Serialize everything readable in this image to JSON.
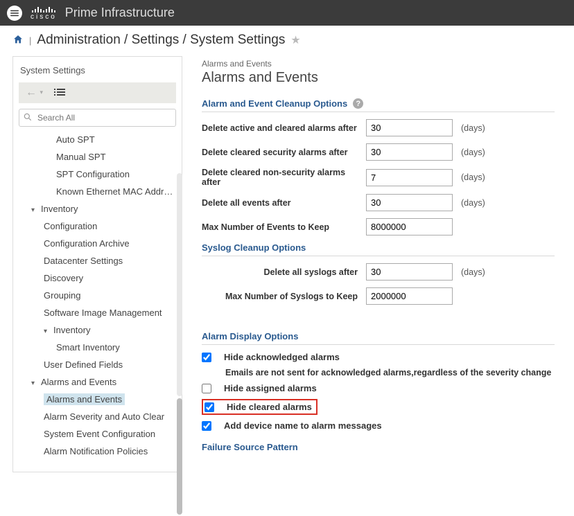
{
  "topbar": {
    "product": "Prime Infrastructure",
    "cisco": "cisco"
  },
  "breadcrumb": {
    "text": "Administration / Settings / System Settings"
  },
  "sidebar": {
    "title": "System Settings",
    "search_placeholder": "Search All",
    "items": [
      {
        "label": "Auto SPT",
        "level": 2,
        "expandable": false
      },
      {
        "label": "Manual SPT",
        "level": 2,
        "expandable": false
      },
      {
        "label": "SPT Configuration",
        "level": 2,
        "expandable": false
      },
      {
        "label": "Known Ethernet MAC Address List",
        "level": 2,
        "expandable": false
      },
      {
        "label": "Inventory",
        "level": 0,
        "expandable": true
      },
      {
        "label": "Configuration",
        "level": 1,
        "expandable": false
      },
      {
        "label": "Configuration Archive",
        "level": 1,
        "expandable": false
      },
      {
        "label": "Datacenter Settings",
        "level": 1,
        "expandable": false
      },
      {
        "label": "Discovery",
        "level": 1,
        "expandable": false
      },
      {
        "label": "Grouping",
        "level": 1,
        "expandable": false
      },
      {
        "label": "Software Image Management",
        "level": 1,
        "expandable": false
      },
      {
        "label": "Inventory",
        "level": 1,
        "expandable": true
      },
      {
        "label": "Smart Inventory",
        "level": 2,
        "expandable": false
      },
      {
        "label": "User Defined Fields",
        "level": 1,
        "expandable": false
      },
      {
        "label": "Alarms and Events",
        "level": 0,
        "expandable": true
      },
      {
        "label": "Alarms and Events",
        "level": 1,
        "expandable": false,
        "selected": true
      },
      {
        "label": "Alarm Severity and Auto Clear",
        "level": 1,
        "expandable": false
      },
      {
        "label": "System Event Configuration",
        "level": 1,
        "expandable": false
      },
      {
        "label": "Alarm Notification Policies",
        "level": 1,
        "expandable": false
      }
    ]
  },
  "main": {
    "crumb": "Alarms and Events",
    "title": "Alarms and Events",
    "sections": {
      "cleanup": {
        "header": "Alarm and Event Cleanup Options",
        "rows": [
          {
            "label": "Delete active and cleared alarms after",
            "value": "30",
            "unit": "(days)"
          },
          {
            "label": "Delete cleared security alarms after",
            "value": "30",
            "unit": "(days)"
          },
          {
            "label": "Delete cleared non-security alarms after",
            "value": "7",
            "unit": "(days)"
          },
          {
            "label": "Delete all events after",
            "value": "30",
            "unit": "(days)"
          },
          {
            "label": "Max Number of Events to Keep",
            "value": "8000000",
            "unit": ""
          }
        ]
      },
      "syslog": {
        "header": "Syslog Cleanup Options",
        "rows": [
          {
            "label": "Delete all syslogs after",
            "value": "30",
            "unit": "(days)"
          },
          {
            "label": "Max Number of Syslogs to Keep",
            "value": "2000000",
            "unit": ""
          }
        ]
      },
      "display": {
        "header": "Alarm Display Options",
        "opts": [
          {
            "label": "Hide acknowledged alarms",
            "checked": true
          },
          {
            "note": "Emails are not sent for acknowledged alarms,regardless of the severity change"
          },
          {
            "label": "Hide assigned alarms",
            "checked": false
          },
          {
            "label": "Hide cleared alarms",
            "checked": true,
            "highlight": true
          },
          {
            "label": "Add device name to alarm messages",
            "checked": true
          }
        ]
      },
      "failure": {
        "header": "Failure Source Pattern"
      }
    }
  }
}
